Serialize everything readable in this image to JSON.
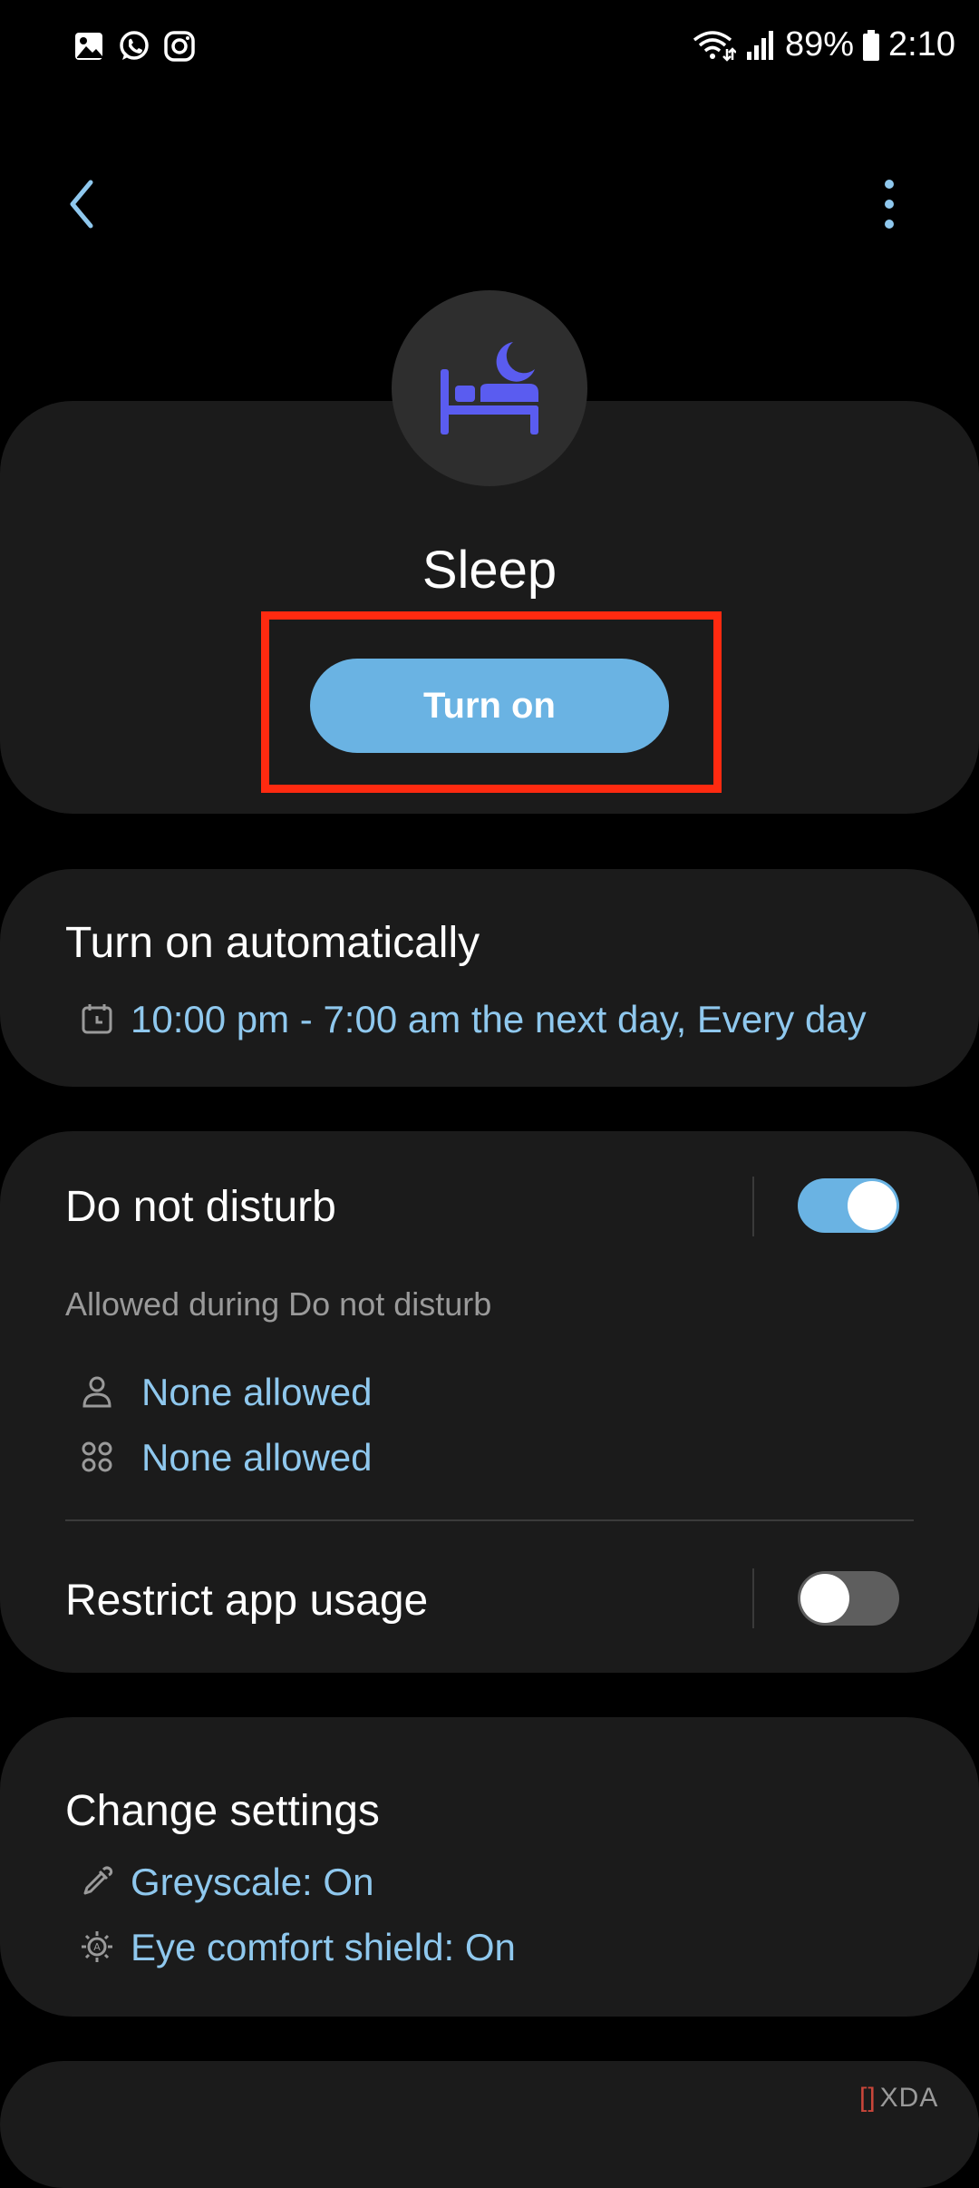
{
  "status_bar": {
    "left_icons": [
      "gallery-icon",
      "whatsapp-icon",
      "instagram-icon"
    ],
    "battery": "89%",
    "time": "2:10"
  },
  "header": {
    "back_icon": "chevron-left-icon",
    "more_icon": "more-vert-icon"
  },
  "mode": {
    "icon": "bed-moon-icon",
    "title": "Sleep",
    "turn_on_label": "Turn on"
  },
  "auto": {
    "title": "Turn on automatically",
    "schedule": "10:00 pm - 7:00 am the next day, Every day"
  },
  "dnd": {
    "title": "Do not disturb",
    "enabled": true,
    "allowed_heading": "Allowed during Do not disturb",
    "people_allowed": "None allowed",
    "apps_allowed": "None allowed"
  },
  "restrict": {
    "title": "Restrict app usage",
    "enabled": false
  },
  "change_settings": {
    "title": "Change settings",
    "greyscale": "Greyscale: On",
    "eye_comfort": "Eye comfort shield: On"
  },
  "watermark": {
    "text": "XDA"
  },
  "colors": {
    "accent": "#6ab3e3",
    "link": "#8fc8ee",
    "icon_purple": "#5a5cf0",
    "highlight": "#ff2a10",
    "card_bg": "#1b1b1b"
  }
}
